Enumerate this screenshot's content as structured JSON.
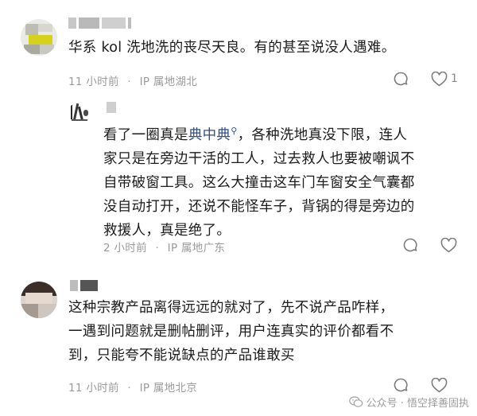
{
  "comments": [
    {
      "text": "华系 kol 洗地洗的丧尽天良。有的甚至说没人遇难。",
      "time": "11 小时前",
      "ip": "IP 属地湖北",
      "likes": "1"
    },
    {
      "text_before": "看了一圈真是",
      "text_highlight": "典中典",
      "text_after_lines": [
        "，各种洗地真没下限，连人",
        "家只是在旁边干活的工人，过去救人也要被嘲讽不",
        "自带破窗工具。这么大撞击这车门车窗安全气囊都",
        "没自动打开，还说不能怪车子，背锅的得是旁边的",
        "救援人，真是绝了。"
      ],
      "time": "2 小时前",
      "ip": "IP 属地广东"
    },
    {
      "lines": [
        "这种宗教产品离得远远的就对了，先不说产品咋样，",
        "一遇到问题就是删帖删评，用户连真实的评价都看不",
        "到，只能夸不能说缺点的产品谁敢买"
      ],
      "time": "11 小时前",
      "ip": "IP 属地北京"
    }
  ],
  "watermark": "公众号 · 悟空择善固执",
  "icons": {
    "reply": "reply-bubble-icon",
    "like": "heart-icon",
    "search": "search-icon",
    "wechat": "wechat-icon"
  }
}
